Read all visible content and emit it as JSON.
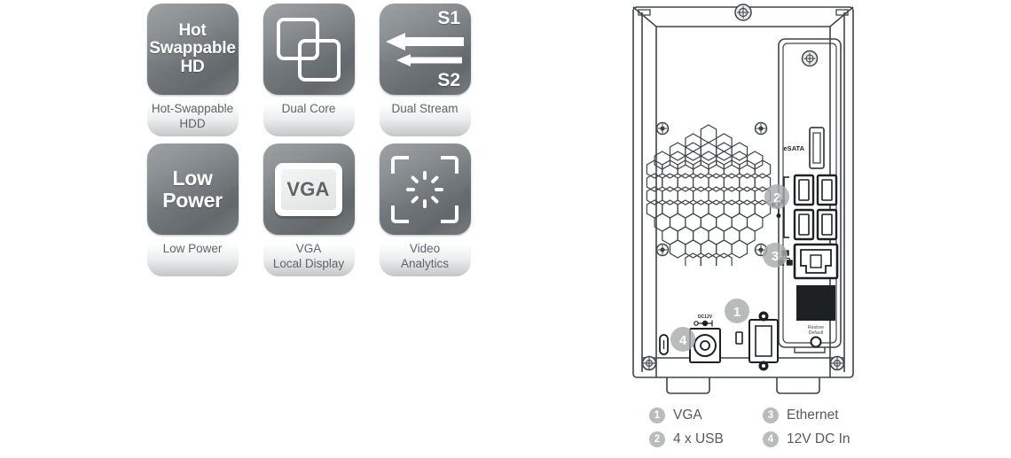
{
  "features": [
    {
      "id": "hot-swappable-hdd",
      "icon": "hot-swappable-hd-text-icon",
      "tile_text_lines": [
        "Hot",
        "Swappable",
        "HD"
      ],
      "label_lines": [
        "Hot-Swappable",
        "HDD"
      ]
    },
    {
      "id": "dual-core",
      "icon": "overlapping-squares-icon",
      "tile_text_lines": [],
      "label_lines": [
        "Dual Core"
      ]
    },
    {
      "id": "dual-stream",
      "icon": "dual-arrow-stream-icon",
      "tile_text_lines": [
        "S1",
        "S2"
      ],
      "label_lines": [
        "Dual Stream"
      ]
    },
    {
      "id": "low-power",
      "icon": "low-power-text-icon",
      "tile_text_lines": [
        "Low",
        "Power"
      ],
      "label_lines": [
        "Low Power"
      ]
    },
    {
      "id": "vga-local-display",
      "icon": "monitor-vga-icon",
      "tile_text_lines": [
        "VGA"
      ],
      "label_lines": [
        "VGA",
        "Local Display"
      ]
    },
    {
      "id": "video-analytics",
      "icon": "focus-brackets-icon",
      "tile_text_lines": [],
      "label_lines": [
        "Video",
        "Analytics"
      ]
    }
  ],
  "device": {
    "name": "nvr-rear-panel-diagram",
    "port_labels": {
      "esata": "eSATA",
      "dc_in": "DC12V",
      "restore_default_line1": "Restore",
      "restore_default_line2": "Default"
    },
    "callouts": [
      {
        "number": "1",
        "target": "vga-port"
      },
      {
        "number": "2",
        "target": "usb-ports"
      },
      {
        "number": "3",
        "target": "ethernet-port"
      },
      {
        "number": "4",
        "target": "dc-in-jack"
      }
    ]
  },
  "legend": {
    "items": [
      {
        "number": "1",
        "label": "VGA"
      },
      {
        "number": "2",
        "label": "4 x USB"
      },
      {
        "number": "3",
        "label": "Ethernet"
      },
      {
        "number": "4",
        "label": "12V DC In"
      }
    ]
  },
  "colors": {
    "tile_gray_light": "#8d9396",
    "tile_gray_dark": "#64696c",
    "label_text": "#5e6468",
    "legend_text": "#58595b",
    "badge_gray": "#b9bcbd",
    "line_stroke": "#3f4447"
  }
}
